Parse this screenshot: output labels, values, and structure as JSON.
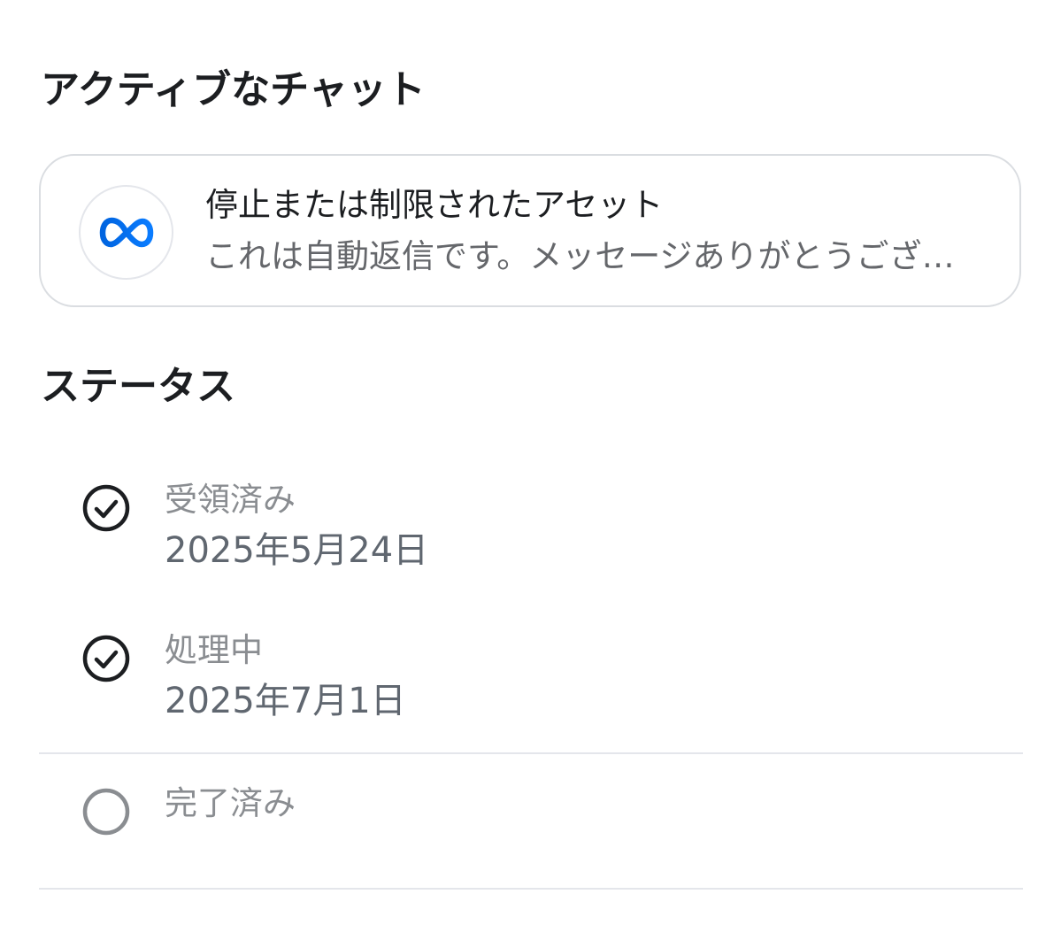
{
  "active_chats": {
    "heading": "アクティブなチャット",
    "chat": {
      "avatar_icon": "meta-logo-icon",
      "brand_color": "#0866ff",
      "title": "停止または制限されたアセット",
      "preview": "これは自動返信です。メッセージありがとうございます。"
    }
  },
  "status": {
    "heading": "ステータス",
    "steps": [
      {
        "label": "受領済み",
        "date": "2025年5月24日",
        "state": "done",
        "icon": "check-circle-icon"
      },
      {
        "label": "処理中",
        "date": "2025年7月1日",
        "state": "done",
        "icon": "check-circle-icon"
      },
      {
        "label": "完了済み",
        "date": "",
        "state": "pending",
        "icon": "empty-circle-icon"
      }
    ]
  }
}
